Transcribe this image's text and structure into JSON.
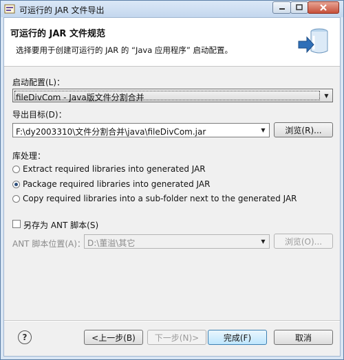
{
  "window": {
    "title": "可运行的 JAR 文件导出",
    "minimize_icon": "minimize-icon",
    "maximize_icon": "maximize-icon",
    "close_icon": "close-icon"
  },
  "header": {
    "title": "可运行的 JAR 文件规范",
    "description": "选择要用于创建可运行的 JAR 的 “Java 应用程序” 启动配置。",
    "graphic_icon": "jar-export-wizard-icon"
  },
  "launch_config": {
    "label": "启动配置(L)：",
    "value": "fileDivCom - Java版文件分割合并"
  },
  "export_target": {
    "label": "导出目标(D)：",
    "value": "F:\\dy2003310\\文件分割合并\\java\\fileDivCom.jar",
    "browse_label": "浏览(R)..."
  },
  "library_handling": {
    "label": "库处理：",
    "options": [
      {
        "label": "Extract required libraries into generated JAR",
        "checked": false
      },
      {
        "label": "Package required libraries into generated JAR",
        "checked": true
      },
      {
        "label": "Copy required libraries into a sub-folder next to the generated JAR",
        "checked": false
      }
    ]
  },
  "ant": {
    "save_label": "另存为 ANT 脚本(S)",
    "checked": false,
    "location_label": "ANT 脚本位置(A)：",
    "location_value": "D:\\董溢\\其它",
    "browse_label": "浏览(O)..."
  },
  "footer": {
    "help_icon": "help-icon",
    "back_label": "<上一步(B)",
    "next_label": "下一步(N)>",
    "finish_label": "完成(F)",
    "cancel_label": "取消"
  }
}
